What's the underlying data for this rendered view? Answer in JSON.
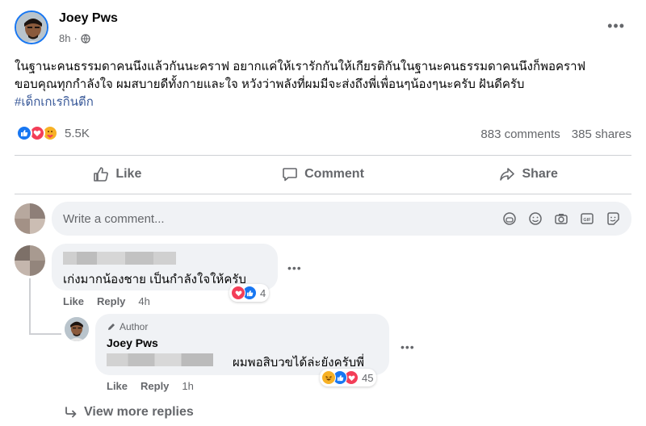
{
  "post": {
    "author": "Joey Pws",
    "time": "8h",
    "privacy_icon": "globe-icon",
    "text_line1": "ในฐานะคนธรรมดาคนนึงแล้วกันนะคราฟ อยากแค่ให้เรารักกันให้เกียรติกันในฐานะคนธรรมดาคนนึงก็พอคราฟ",
    "text_line2": "ขอบคุณทุกกำลังใจ ผมสบายดีทั้งกายและใจ หวังว่าพลังที่ผมมีจะส่งถึงพี่เพื่อนๆน้องๆนะครับ ฝันดีครับ",
    "hashtag": "#เด็กเกเรกินตีก",
    "reaction_count": "5.5K",
    "comments_count": "883 comments",
    "shares_count": "385 shares"
  },
  "actions": {
    "like": "Like",
    "comment": "Comment",
    "share": "Share"
  },
  "composer": {
    "placeholder": "Write a comment..."
  },
  "comments": [
    {
      "text": "เก่งมากน้องชาย เป็นกำลังใจให้ครับ",
      "like": "Like",
      "reply": "Reply",
      "time": "4h",
      "reaction_count": "4"
    }
  ],
  "reply": {
    "badge": "Author",
    "name": "Joey Pws",
    "text": "ผมพอสิบวขได้ล่ะยังครับพี่",
    "like": "Like",
    "reply": "Reply",
    "time": "1h",
    "reaction_count": "45"
  },
  "view_more": "View more replies",
  "colors": {
    "accent": "#1877f2",
    "love": "#f33e58",
    "haha": "#f7b125",
    "muted": "#65676b"
  }
}
